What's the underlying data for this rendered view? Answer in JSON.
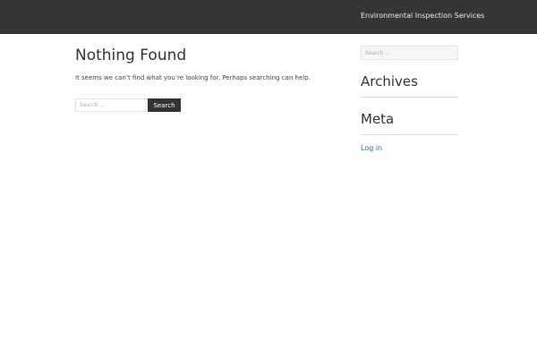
{
  "header": {
    "site_title": "Environmental Inspection Services"
  },
  "main": {
    "title": "Nothing Found",
    "message": "It seems we can’t find what you’re looking for. Perhaps searching can help.",
    "search": {
      "placeholder": "Search …",
      "button_label": "Search"
    }
  },
  "sidebar": {
    "search": {
      "placeholder": "Search …"
    },
    "archives_title": "Archives",
    "meta_title": "Meta",
    "meta_links": [
      {
        "label": "Log in"
      }
    ]
  },
  "colors": {
    "header_bg": "#353535",
    "button_bg": "#333333",
    "link": "#21759b"
  }
}
